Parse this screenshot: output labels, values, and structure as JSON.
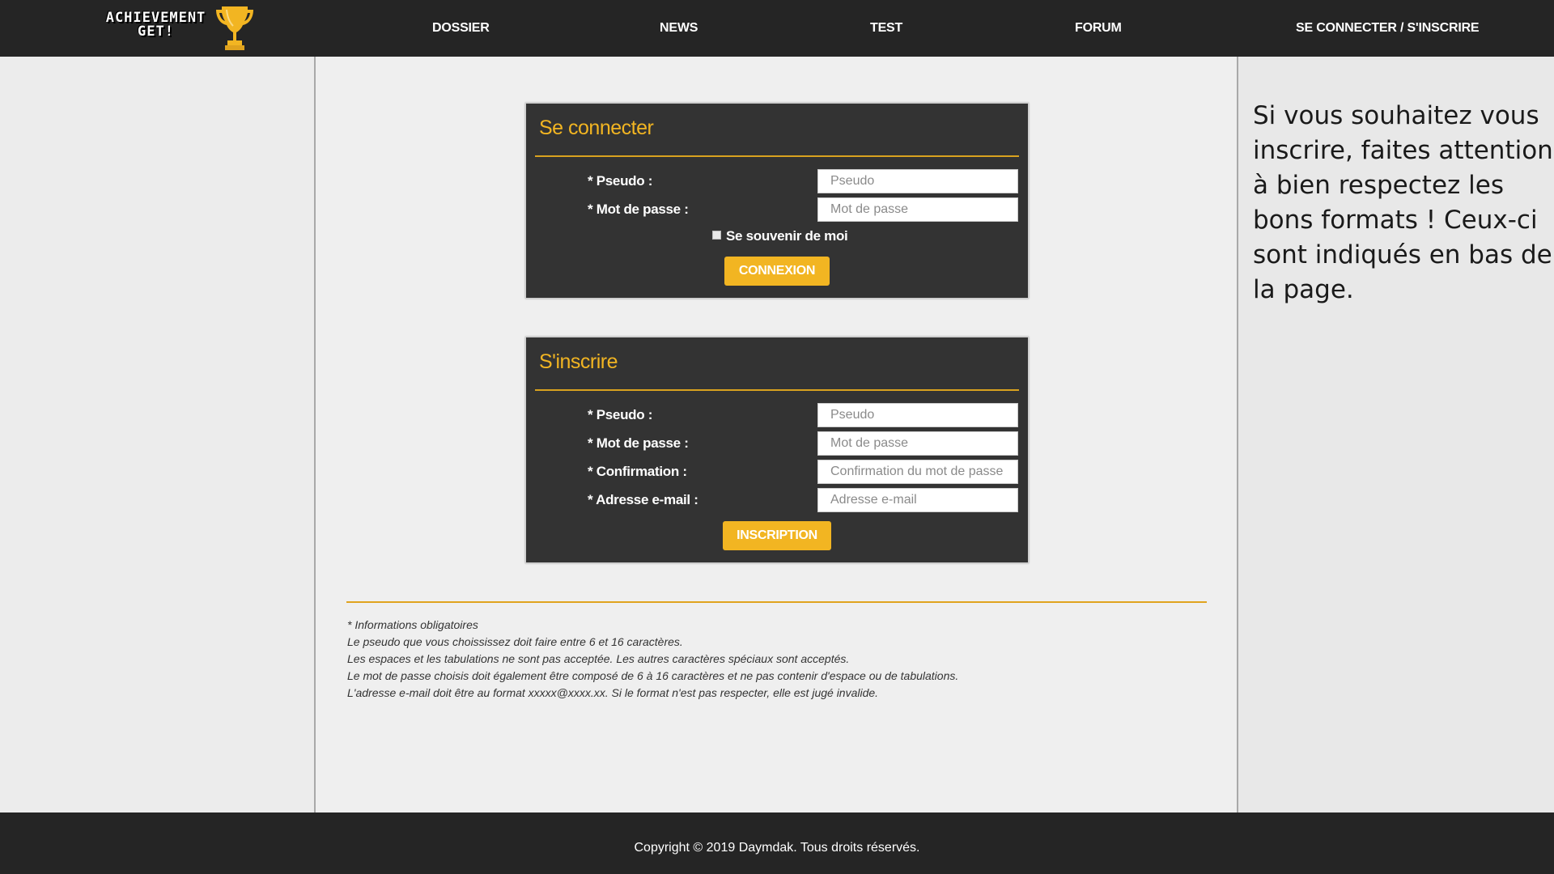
{
  "brand": {
    "line1": "ACHIEVEMENT",
    "line2": "GET!",
    "icon": "trophy-icon",
    "accent_color": "#f2b522"
  },
  "nav": {
    "items": [
      {
        "label": "DOSSIER"
      },
      {
        "label": "NEWS"
      },
      {
        "label": "TEST"
      },
      {
        "label": "FORUM"
      },
      {
        "label": "SE CONNECTER / S'INSCRIRE"
      }
    ]
  },
  "login": {
    "title": "Se connecter",
    "fields": [
      {
        "label": "* Pseudo :",
        "placeholder": "Pseudo",
        "value": ""
      },
      {
        "label": "* Mot de passe :",
        "placeholder": "Mot de passe",
        "value": ""
      }
    ],
    "remember_label": "Se souvenir de moi",
    "remember_checked": false,
    "submit_label": "CONNEXION"
  },
  "register": {
    "title": "S'inscrire",
    "fields": [
      {
        "label": "* Pseudo :",
        "placeholder": "Pseudo",
        "value": ""
      },
      {
        "label": "* Mot de passe :",
        "placeholder": "Mot de passe",
        "value": ""
      },
      {
        "label": "* Confirmation :",
        "placeholder": "Confirmation du mot de passe",
        "value": ""
      },
      {
        "label": "* Adresse e-mail :",
        "placeholder": "Adresse e-mail",
        "value": ""
      }
    ],
    "submit_label": "INSCRIPTION"
  },
  "info": {
    "lines": [
      "* Informations obligatoires",
      "Le pseudo que vous choississez doit faire entre 6 et 16 caractères.",
      "Les espaces et les tabulations ne sont pas acceptée. Les autres caractères spéciaux sont acceptés.",
      "Le mot de passe choisis doit également être composé de 6 à 16 caractères et ne pas contenir d'espace ou de tabulations.",
      "L'adresse e-mail doit être au format xxxxx@xxxx.xx. Si le format n'est pas respecter, elle est jugé invalide."
    ]
  },
  "aside": {
    "text": "Si vous souhaitez vous inscrire, faites attention à bien respectez les bons formats ! Ceux-ci sont indiqués en bas de la page."
  },
  "footer": {
    "copyright": "Copyright © 2019 Daymdak. Tous droits réservés."
  }
}
